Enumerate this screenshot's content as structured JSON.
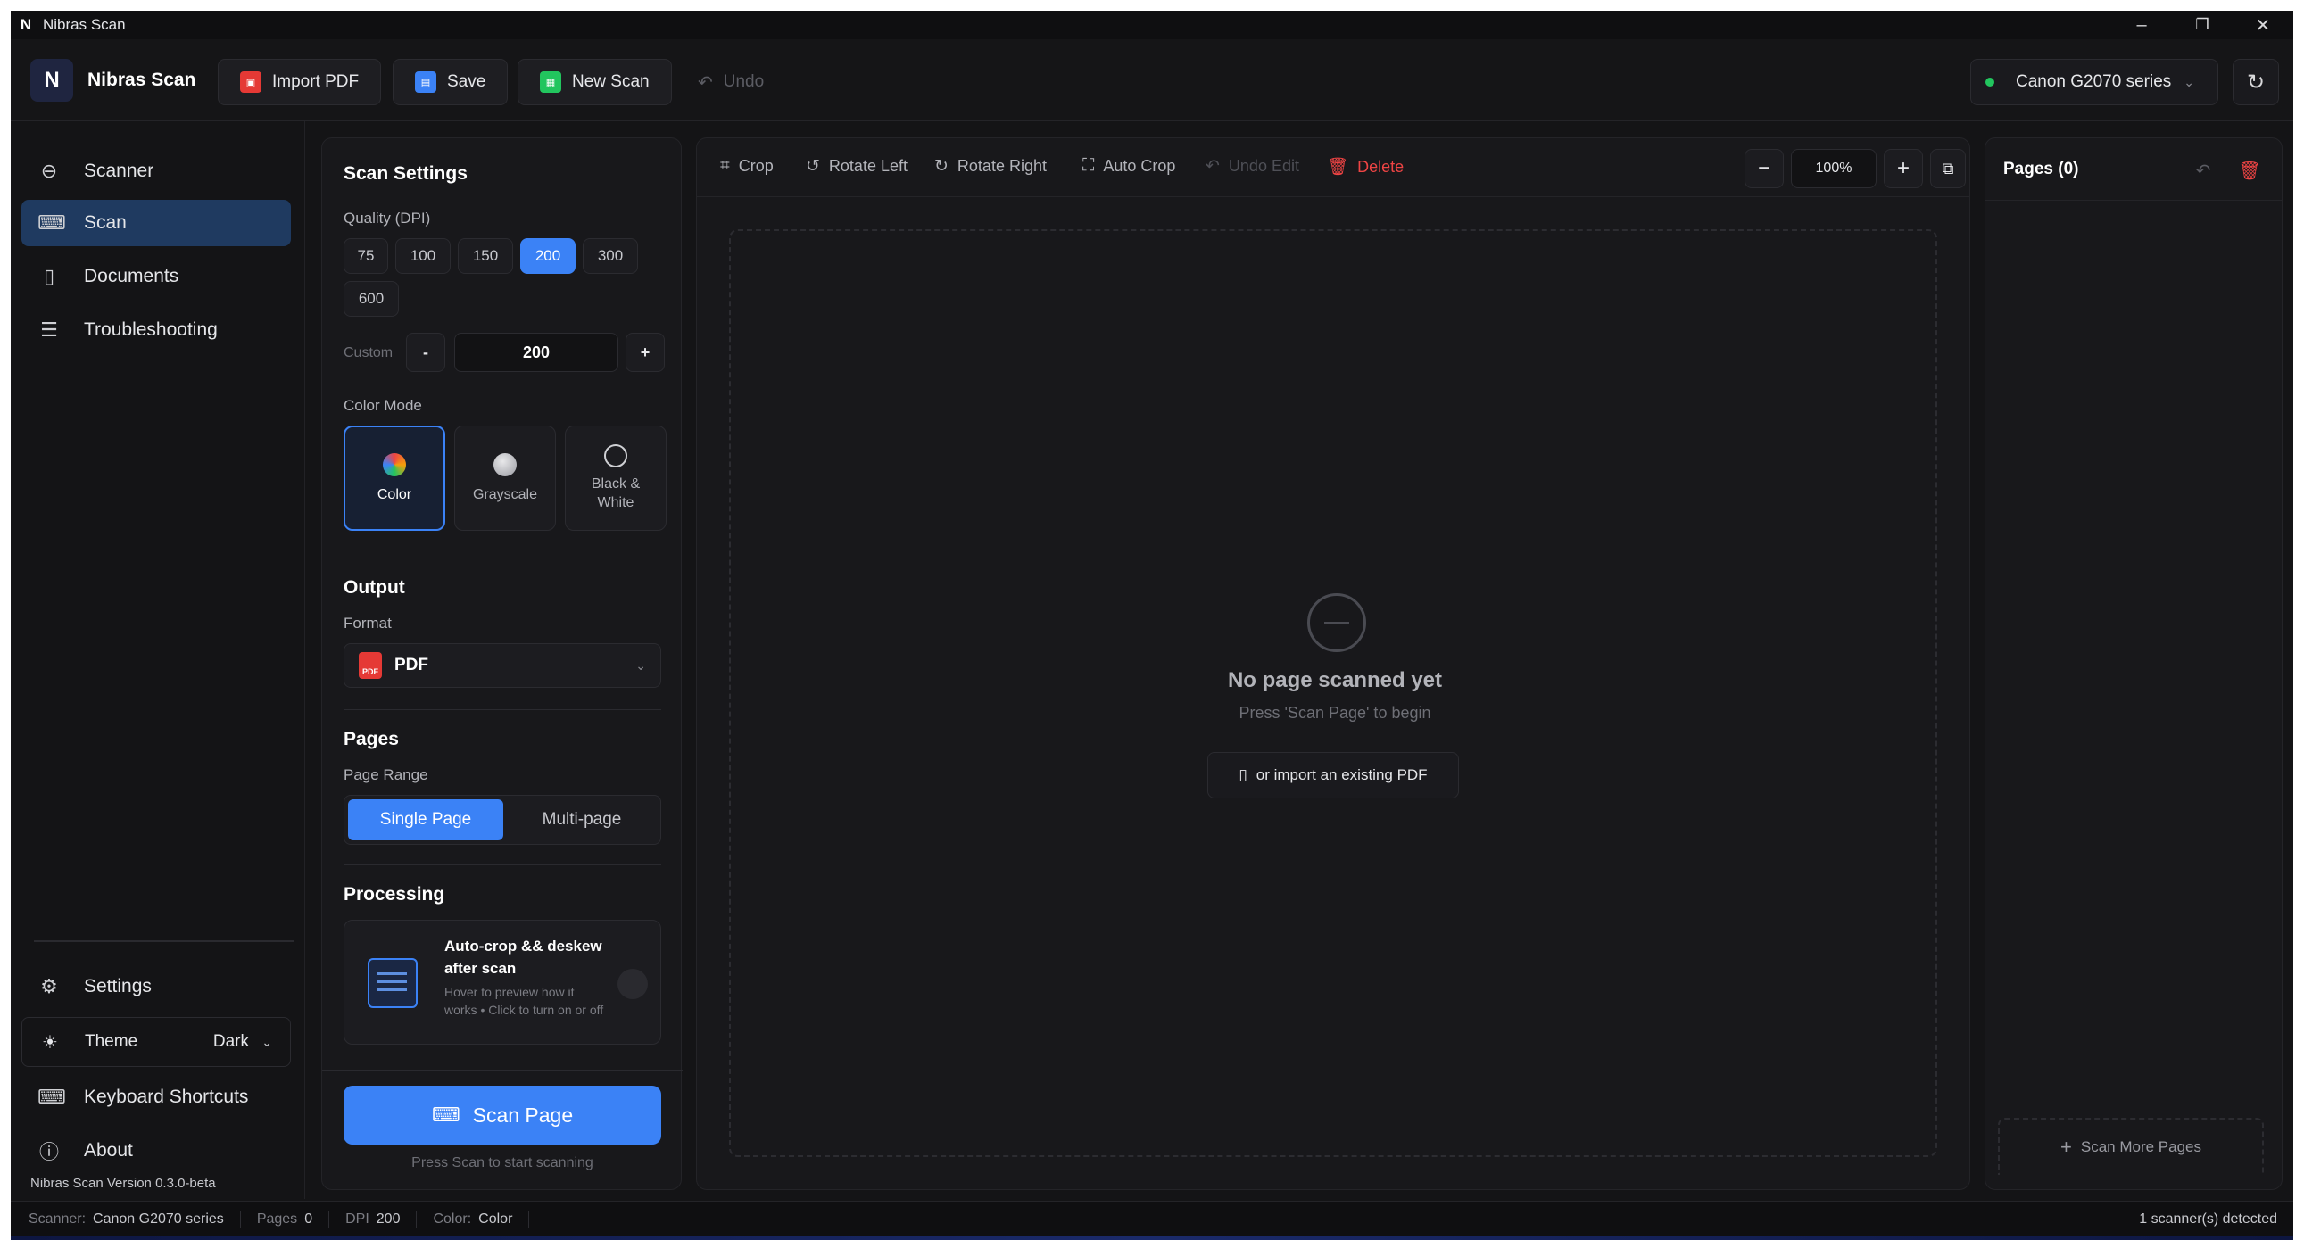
{
  "window": {
    "logo_letter": "N",
    "title": "Nibras Scan",
    "controls": {
      "minimize": "–",
      "maximize": "❐",
      "close": "✕"
    }
  },
  "header": {
    "brand_letter": "N",
    "brand_name": "Nibras Scan",
    "import_pdf": "Import PDF",
    "save": "Save",
    "new_scan": "New Scan",
    "undo": "Undo",
    "scanner_name": "Canon G2070 series",
    "scanner_status_color": "#22c55e"
  },
  "sidebar": {
    "items": [
      {
        "label": "Scanner",
        "icon": "power-circle-icon"
      },
      {
        "label": "Scan",
        "icon": "laptop-icon"
      },
      {
        "label": "Documents",
        "icon": "document-icon"
      },
      {
        "label": "Troubleshooting",
        "icon": "list-icon"
      }
    ],
    "settings": "Settings",
    "theme_label": "Theme",
    "theme_value": "Dark",
    "shortcuts": "Keyboard Shortcuts",
    "about": "About",
    "version": "Nibras Scan Version 0.3.0-beta"
  },
  "settings": {
    "title": "Scan Settings",
    "quality_label": "Quality (DPI)",
    "dpi_options": [
      "75",
      "100",
      "150",
      "200",
      "300",
      "600"
    ],
    "dpi_selected": "200",
    "custom_label": "Custom",
    "custom_minus": "-",
    "custom_plus": "+",
    "custom_value": "200",
    "color_mode_label": "Color Mode",
    "color_modes": [
      "Color",
      "Grayscale",
      "Black & White"
    ],
    "color_mode_selected": "Color",
    "output_title": "Output",
    "format_label": "Format",
    "format_value": "PDF",
    "format_icon_text": "PDF",
    "pages_title": "Pages",
    "page_range_label": "Page Range",
    "page_range_options": [
      "Single Page",
      "Multi-page"
    ],
    "page_range_selected": "Single Page",
    "processing_title": "Processing",
    "processing_option_title": "Auto-crop && deskew after scan",
    "processing_option_desc": "Hover to preview how it works • Click to turn on or off",
    "scan_button": "Scan Page",
    "scan_hint": "Press Scan to start scanning",
    "accent_color": "#3b82f6"
  },
  "editor": {
    "crop": "Crop",
    "rotate_left": "Rotate Left",
    "rotate_right": "Rotate Right",
    "auto_crop": "Auto Crop",
    "undo_edit": "Undo Edit",
    "delete": "Delete",
    "zoom": "100%",
    "zoom_out": "−",
    "zoom_in": "+",
    "empty_title": "No page scanned yet",
    "empty_subtitle": "Press 'Scan Page' to begin",
    "import_existing": "or import an existing PDF"
  },
  "pages": {
    "title": "Pages (0)",
    "scan_more": "Scan More Pages"
  },
  "statusbar": {
    "scanner_label": "Scanner:",
    "scanner_value": "Canon G2070 series",
    "pages_label": "Pages",
    "pages_value": "0",
    "dpi_label": "DPI",
    "dpi_value": "200",
    "color_label": "Color:",
    "color_value": "Color",
    "detected": "1 scanner(s) detected"
  }
}
